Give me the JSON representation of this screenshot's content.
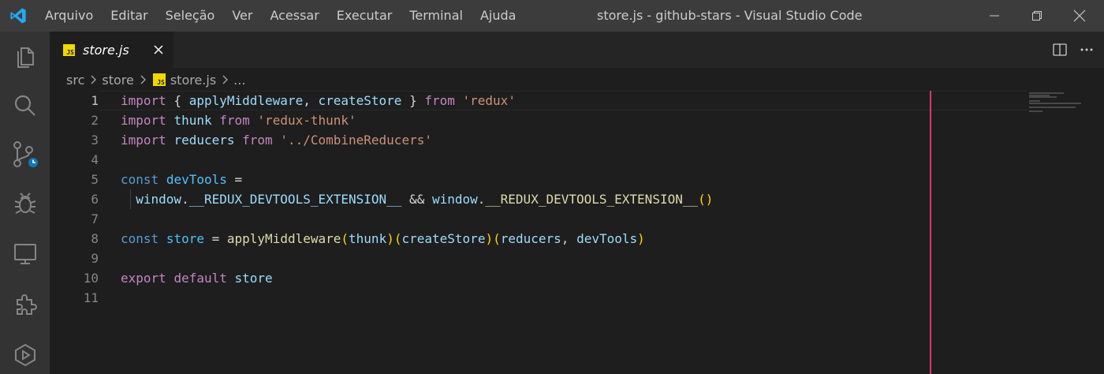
{
  "window": {
    "title": "store.js - github-stars - Visual Studio Code",
    "menu": [
      "Arquivo",
      "Editar",
      "Seleção",
      "Ver",
      "Acessar",
      "Executar",
      "Terminal",
      "Ajuda"
    ],
    "controls": [
      "minimize-icon",
      "restore-icon",
      "close-icon"
    ]
  },
  "activity_bar": [
    {
      "name": "explorer",
      "icon": "files-icon"
    },
    {
      "name": "search",
      "icon": "search-icon"
    },
    {
      "name": "source-control",
      "icon": "source-control-icon",
      "badge_icon": "clock-icon"
    },
    {
      "name": "run-debug",
      "icon": "bug-icon"
    },
    {
      "name": "remote-explorer",
      "icon": "monitor-icon"
    },
    {
      "name": "extensions",
      "icon": "puzzle-icon"
    },
    {
      "name": "run",
      "icon": "play-icon"
    }
  ],
  "tab": {
    "label": "store.js",
    "badge": "JS"
  },
  "editor_actions": [
    "split-editor-icon",
    "more-actions-icon"
  ],
  "breadcrumb": {
    "segments": [
      "src",
      "store",
      "store.js",
      "..."
    ]
  },
  "editor": {
    "line_numbers": [
      "1",
      "2",
      "3",
      "4",
      "5",
      "6",
      "7",
      "8",
      "9",
      "10",
      "11"
    ],
    "active_line": "1",
    "lines": [
      [
        {
          "t": "import",
          "c": "kw"
        },
        {
          "t": " { ",
          "c": "plain"
        },
        {
          "t": "applyMiddleware",
          "c": "var"
        },
        {
          "t": ", ",
          "c": "plain"
        },
        {
          "t": "createStore",
          "c": "var"
        },
        {
          "t": " } ",
          "c": "plain"
        },
        {
          "t": "from",
          "c": "kw"
        },
        {
          "t": " ",
          "c": "plain"
        },
        {
          "t": "'redux'",
          "c": "str"
        }
      ],
      [
        {
          "t": "import",
          "c": "kw"
        },
        {
          "t": " ",
          "c": "plain"
        },
        {
          "t": "thunk",
          "c": "var"
        },
        {
          "t": " ",
          "c": "plain"
        },
        {
          "t": "from",
          "c": "kw"
        },
        {
          "t": " ",
          "c": "plain"
        },
        {
          "t": "'redux-thunk'",
          "c": "str"
        }
      ],
      [
        {
          "t": "import",
          "c": "kw"
        },
        {
          "t": " ",
          "c": "plain"
        },
        {
          "t": "reducers",
          "c": "var"
        },
        {
          "t": " ",
          "c": "plain"
        },
        {
          "t": "from",
          "c": "kw"
        },
        {
          "t": " ",
          "c": "plain"
        },
        {
          "t": "'../CombineReducers'",
          "c": "str"
        }
      ],
      [],
      [
        {
          "t": "const",
          "c": "decl"
        },
        {
          "t": " ",
          "c": "plain"
        },
        {
          "t": "devTools",
          "c": "cst"
        },
        {
          "t": " =",
          "c": "plain"
        }
      ],
      [
        {
          "t": "  ",
          "c": "plain"
        },
        {
          "t": "window",
          "c": "var"
        },
        {
          "t": ".",
          "c": "plain"
        },
        {
          "t": "__REDUX_DEVTOOLS_EXTENSION__",
          "c": "var"
        },
        {
          "t": " && ",
          "c": "plain"
        },
        {
          "t": "window",
          "c": "var"
        },
        {
          "t": ".",
          "c": "plain"
        },
        {
          "t": "__REDUX_DEVTOOLS_EXTENSION__",
          "c": "fn"
        },
        {
          "t": "()",
          "c": "br1"
        }
      ],
      [],
      [
        {
          "t": "const",
          "c": "decl"
        },
        {
          "t": " ",
          "c": "plain"
        },
        {
          "t": "store",
          "c": "cst"
        },
        {
          "t": " = ",
          "c": "plain"
        },
        {
          "t": "applyMiddleware",
          "c": "fn"
        },
        {
          "t": "(",
          "c": "br1"
        },
        {
          "t": "thunk",
          "c": "var"
        },
        {
          "t": ")",
          "c": "br1"
        },
        {
          "t": "(",
          "c": "br1"
        },
        {
          "t": "createStore",
          "c": "var"
        },
        {
          "t": ")",
          "c": "br1"
        },
        {
          "t": "(",
          "c": "br1"
        },
        {
          "t": "reducers",
          "c": "var"
        },
        {
          "t": ", ",
          "c": "plain"
        },
        {
          "t": "devTools",
          "c": "var"
        },
        {
          "t": ")",
          "c": "br1"
        }
      ],
      [],
      [
        {
          "t": "export",
          "c": "kw"
        },
        {
          "t": " ",
          "c": "plain"
        },
        {
          "t": "default",
          "c": "kw"
        },
        {
          "t": " ",
          "c": "plain"
        },
        {
          "t": "store",
          "c": "var"
        }
      ],
      []
    ]
  },
  "colors": {
    "titlebar": "#3c3c3c",
    "activity_bar": "#333333",
    "editor_bg": "#1e1e1e",
    "ruler": "#e0336e",
    "js_badge": "#f1d800"
  }
}
